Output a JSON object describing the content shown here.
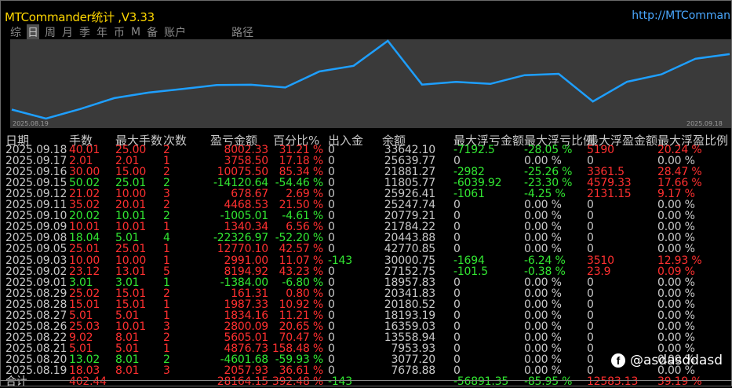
{
  "window": {
    "title": "MTCommander统计 ,V3.33",
    "url": "http://MTComman"
  },
  "tabs": [
    {
      "label": "综",
      "active": false
    },
    {
      "label": "日",
      "active": true
    },
    {
      "label": "周",
      "active": false
    },
    {
      "label": "月",
      "active": false
    },
    {
      "label": "季",
      "active": false
    },
    {
      "label": "年",
      "active": false
    },
    {
      "label": "币",
      "active": false
    },
    {
      "label": "M",
      "active": false
    },
    {
      "label": "备",
      "active": false
    },
    {
      "label": "账户",
      "active": false
    },
    {
      "label": "路径",
      "active": false
    }
  ],
  "chart_data": {
    "type": "line",
    "x_start_label": "2025.08.19",
    "x_end_label": "2025.09.18",
    "line_color": "#1e9fff",
    "x": [
      "2025.08.19",
      "2025.08.20",
      "2025.08.21",
      "2025.08.22",
      "2025.08.25",
      "2025.08.26",
      "2025.08.27",
      "2025.08.28",
      "2025.08.29",
      "2025.09.01",
      "2025.09.02",
      "2025.09.03",
      "2025.09.05",
      "2025.09.08",
      "2025.09.09",
      "2025.09.10",
      "2025.09.11",
      "2025.09.12",
      "2025.09.15",
      "2025.09.16",
      "2025.09.17",
      "2025.09.18"
    ],
    "values": [
      7678.88,
      3077.2,
      7953.93,
      13558.94,
      16359.03,
      18193.19,
      20180.52,
      20341.83,
      18957.83,
      27152.75,
      30000.75,
      42770.85,
      20443.88,
      21784.22,
      20779.21,
      25247.74,
      25926.41,
      11805.77,
      21881.27,
      25639.77,
      33642.1,
      36000.0
    ]
  },
  "table": {
    "headers": [
      "日期",
      "手数",
      "最大手数",
      "次数",
      "盈亏金额",
      "百分比%",
      "出入金",
      "余额",
      "最大浮亏金额",
      "最大浮亏比例",
      "最大浮盈金额",
      "最大浮盈比例"
    ],
    "rows": [
      [
        "2025.09.18",
        "40.01",
        "25.00",
        "2",
        "8002.33",
        "31.21 %",
        "0",
        "33642.10",
        "-7192.5",
        "-28.05 %",
        "5190",
        "20.24 %"
      ],
      [
        "2025.09.17",
        "2.01",
        "2.01",
        "1",
        "3758.50",
        "17.18 %",
        "0",
        "25639.77",
        "0",
        "0.00 %",
        "0",
        "0.00 %"
      ],
      [
        "2025.09.16",
        "30.00",
        "15.00",
        "2",
        "10075.50",
        "85.34 %",
        "0",
        "21881.27",
        "-2982",
        "-25.26 %",
        "3361.5",
        "28.47 %"
      ],
      [
        "2025.09.15",
        "50.02",
        "25.01",
        "2",
        "-14120.64",
        "-54.46 %",
        "0",
        "11805.77",
        "-6039.92",
        "-23.30 %",
        "4579.33",
        "17.66 %"
      ],
      [
        "2025.09.12",
        "21.02",
        "10.00",
        "3",
        "678.67",
        "2.69 %",
        "0",
        "25926.41",
        "-1061",
        "-4.25 %",
        "2131.15",
        "9.17 %"
      ],
      [
        "2025.09.11",
        "35.02",
        "20.01",
        "2",
        "4468.53",
        "21.50 %",
        "0",
        "25247.74",
        "0",
        "0.00 %",
        "0",
        "0.00 %"
      ],
      [
        "2025.09.10",
        "20.02",
        "10.01",
        "2",
        "-1005.01",
        "-4.61 %",
        "0",
        "20779.21",
        "0",
        "0.00 %",
        "0",
        "0.00 %"
      ],
      [
        "2025.09.09",
        "10.01",
        "10.01",
        "1",
        "1340.34",
        "6.56 %",
        "0",
        "21784.22",
        "0",
        "0.00 %",
        "0",
        "0.00 %"
      ],
      [
        "2025.09.08",
        "18.04",
        "5.01",
        "4",
        "-22326.97",
        "-52.20 %",
        "0",
        "20443.88",
        "0",
        "0.00 %",
        "0",
        "0.00 %"
      ],
      [
        "2025.09.05",
        "25.01",
        "25.01",
        "1",
        "12770.10",
        "42.57 %",
        "0",
        "42770.85",
        "0",
        "0.00 %",
        "0",
        "0.00 %"
      ],
      [
        "2025.09.03",
        "10.00",
        "10.00",
        "1",
        "2991.00",
        "11.07 %",
        "-143",
        "30000.75",
        "-1694",
        "-6.24 %",
        "3510",
        "12.93 %"
      ],
      [
        "2025.09.02",
        "23.12",
        "13.01",
        "5",
        "8194.92",
        "43.23 %",
        "0",
        "27152.75",
        "-101.5",
        "-0.38 %",
        "23.9",
        "0.09 %"
      ],
      [
        "2025.09.01",
        "3.01",
        "3.01",
        "1",
        "-1384.00",
        "-6.80 %",
        "0",
        "18957.83",
        "0",
        "0.00 %",
        "0",
        "0.00 %"
      ],
      [
        "2025.08.29",
        "25.02",
        "15.01",
        "2",
        "161.31",
        "0.80 %",
        "0",
        "20341.83",
        "0",
        "0.00 %",
        "0",
        "0.00 %"
      ],
      [
        "2025.08.28",
        "15.01",
        "15.01",
        "1",
        "1987.33",
        "10.92 %",
        "0",
        "20180.52",
        "0",
        "0.00 %",
        "0",
        "0.00 %"
      ],
      [
        "2025.08.27",
        "5.01",
        "5.01",
        "1",
        "1834.16",
        "11.21 %",
        "0",
        "18193.19",
        "0",
        "0.00 %",
        "0",
        "0.00 %"
      ],
      [
        "2025.08.26",
        "25.03",
        "10.01",
        "3",
        "2800.09",
        "20.65 %",
        "0",
        "16359.03",
        "0",
        "0.00 %",
        "0",
        "0.00 %"
      ],
      [
        "2025.08.22",
        "9.02",
        "8.01",
        "2",
        "5605.01",
        "70.47 %",
        "0",
        "13558.94",
        "0",
        "0.00 %",
        "0",
        "0.00 %"
      ],
      [
        "2025.08.21",
        "5.01",
        "5.01",
        "1",
        "4876.73",
        "158.48 %",
        "0",
        "7953.93",
        "0",
        "0.00 %",
        "0",
        "0.00 %"
      ],
      [
        "2025.08.20",
        "13.02",
        "8.01",
        "2",
        "-4601.68",
        "-59.93 %",
        "0",
        "3077.20",
        "0",
        "0.00 %",
        "0",
        "0.00 %"
      ],
      [
        "2025.08.19",
        "18.03",
        "8.01",
        "3",
        "2057.93",
        "36.61 %",
        "0",
        "7678.88",
        "0",
        "0.00 %",
        "0",
        "0.00 %"
      ]
    ],
    "totals": [
      "合计",
      "402.44",
      "",
      "",
      "28164.15",
      "392.48 %",
      "-143",
      "",
      "-56891.35",
      "-85.95 %",
      "12583.13",
      "39.19 %"
    ]
  },
  "watermark": {
    "text": "@asdasddasd",
    "icon": "facebook-icon"
  },
  "colors": {
    "positive": "#ff3030",
    "negative": "#32e632",
    "neutral": "#c8c8c8",
    "title": "#ffd700",
    "link": "#4aa8ff"
  }
}
